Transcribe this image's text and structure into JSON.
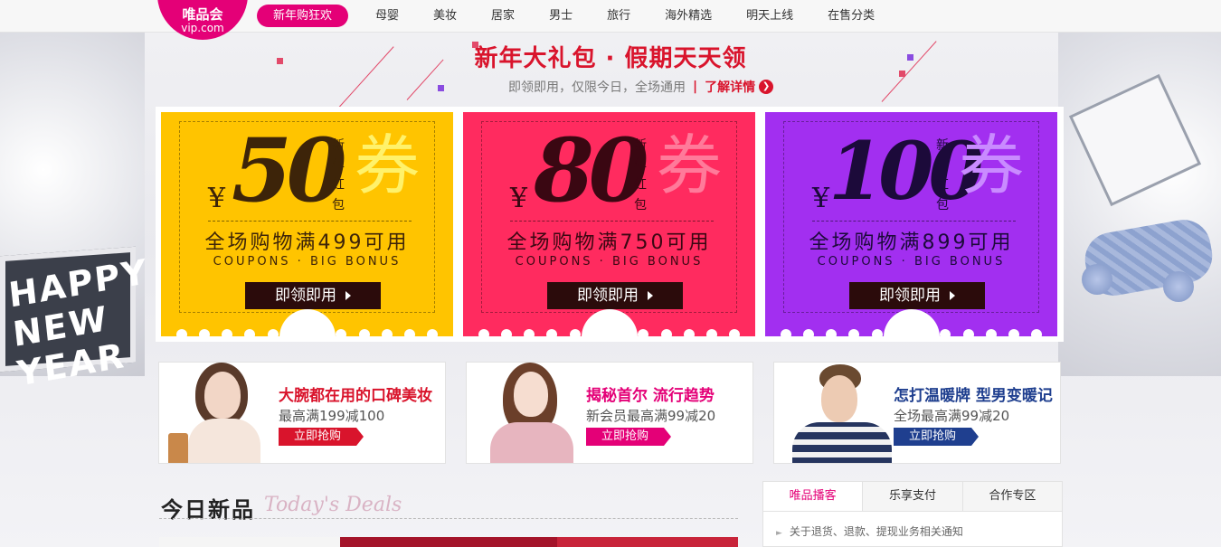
{
  "logo": {
    "cn": "唯品会",
    "en": "vip.com"
  },
  "nav": {
    "items": [
      {
        "label": "新年购狂欢",
        "active": true
      },
      {
        "label": "母婴"
      },
      {
        "label": "美妆"
      },
      {
        "label": "居家"
      },
      {
        "label": "男士"
      },
      {
        "label": "旅行"
      },
      {
        "label": "海外精选"
      },
      {
        "label": "明天上线"
      },
      {
        "label": "在售分类"
      }
    ]
  },
  "banner": {
    "headline": "新年大礼包 · 假期天天领",
    "subline": "即领即用，仅限今日，全场通用",
    "separator": "|",
    "detail_link": "了解详情",
    "bg_text": "HAPPY NEW YEAR"
  },
  "coupons": [
    {
      "yen": "¥",
      "amount": "50",
      "vertical": [
        "新",
        "年",
        "红",
        "包"
      ],
      "quan": "券",
      "condition": "全场购物满499可用",
      "en": "COUPONS · BIG BONUS",
      "button": "即领即用",
      "bg": "#ffc400",
      "ink": "#3d2409",
      "quan_color": "#fff26b"
    },
    {
      "yen": "¥",
      "amount": "80",
      "vertical": [
        "新",
        "年",
        "红",
        "包"
      ],
      "quan": "券",
      "condition": "全场购物满750可用",
      "en": "COUPONS · BIG BONUS",
      "button": "即领即用",
      "bg": "#ff2b5f",
      "ink": "#3a0712",
      "quan_color": "#ff7a9a"
    },
    {
      "yen": "¥",
      "amount": "100",
      "vertical": [
        "新",
        "年",
        "红",
        "包"
      ],
      "quan": "券",
      "condition": "全场购物满899可用",
      "en": "COUPONS · BIG BONUS",
      "button": "即领即用",
      "bg": "#a22ff0",
      "ink": "#1c0a3a",
      "quan_color": "#c98bff"
    }
  ],
  "promos": [
    {
      "title": "大腕都在用的口碑美妆",
      "desc": "最高满199减100",
      "cta": "立即抢购",
      "title_color": "#d9142c",
      "cta_color": "#d9142c"
    },
    {
      "title": "揭秘首尔 流行趋势",
      "desc": "新会员最高满99减20",
      "cta": "立即抢购",
      "title_color": "#e40077",
      "cta_color": "#e40077"
    },
    {
      "title": "怎打温暖牌 型男变暖记",
      "desc": "全场最高满99减20",
      "cta": "立即抢购",
      "title_color": "#1f3f8f",
      "cta_color": "#1f3f8f"
    }
  ],
  "deals": {
    "title": "今日新品",
    "subtitle": "Today's Deals"
  },
  "notice": {
    "tabs": [
      "唯品播客",
      "乐享支付",
      "合作专区"
    ],
    "items": [
      "关于退货、退款、提现业务相关通知"
    ]
  }
}
